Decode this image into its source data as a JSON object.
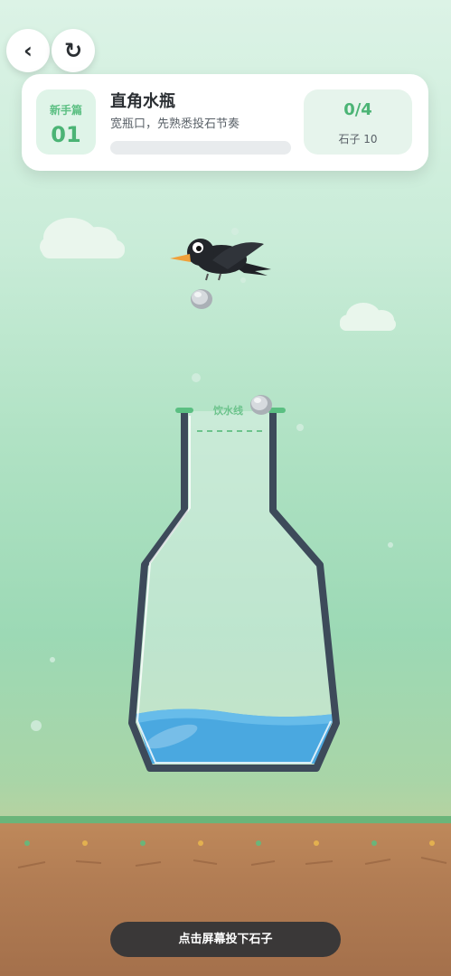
{
  "nav": {
    "back_icon": "‹",
    "reload_icon": "↻"
  },
  "level": {
    "chapter": "新手篇",
    "number": "01",
    "title": "直角水瓶",
    "subtitle": "宽瓶口，先熟悉投石节奏",
    "progress": 0
  },
  "score": {
    "value": "0/4",
    "stones": "石子 10"
  },
  "bottle": {
    "water_line_label": "饮水线"
  },
  "hint": "点击屏幕投下石子",
  "colors": {
    "accent": "#4bb475",
    "water": "#4aa8e0",
    "bottle_outline": "#3d4a5a",
    "ground": "#b27d54"
  },
  "icons": [
    "back-arrow-icon",
    "reload-icon",
    "crow",
    "stone",
    "cloud"
  ]
}
